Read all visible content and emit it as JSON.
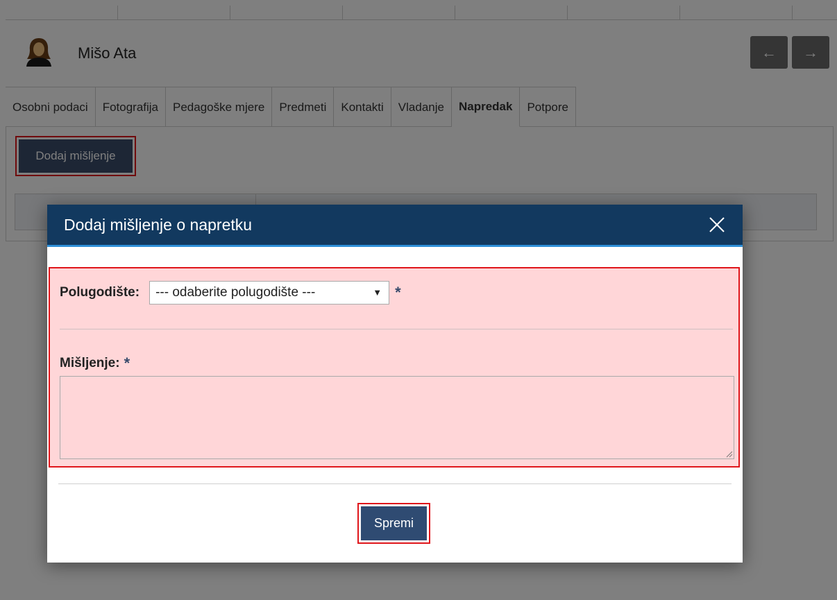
{
  "student": {
    "name": "Mišo Ata"
  },
  "tabs": [
    {
      "label": "Osobni podaci",
      "active": false
    },
    {
      "label": "Fotografija",
      "active": false
    },
    {
      "label": "Pedagoške mjere",
      "active": false
    },
    {
      "label": "Predmeti",
      "active": false
    },
    {
      "label": "Kontakti",
      "active": false
    },
    {
      "label": "Vladanje",
      "active": false
    },
    {
      "label": "Napredak",
      "active": true
    },
    {
      "label": "Potpore",
      "active": false
    }
  ],
  "panel": {
    "add_opinion_label": "Dodaj mišljenje"
  },
  "modal": {
    "title": "Dodaj mišljenje o napretku",
    "semester": {
      "label": "Polugodište:",
      "selected": "--- odaberite polugodište ---",
      "required": "*"
    },
    "opinion": {
      "label": "Mišljenje:",
      "required": "*",
      "value": ""
    },
    "save_label": "Spremi"
  },
  "icons": {
    "avatar": "user-female-icon",
    "prev": "arrow-left-icon",
    "next": "arrow-right-icon",
    "close": "close-icon"
  },
  "colors": {
    "modal_header": "#12395f",
    "highlight_border": "#e0161b",
    "highlight_fill": "#ffd6d8",
    "button": "#2f4b72"
  }
}
